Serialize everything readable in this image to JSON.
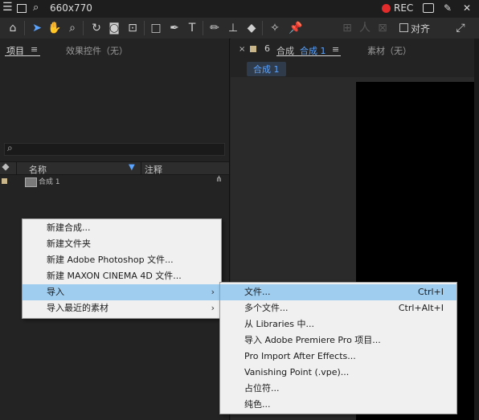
{
  "capture_bar": {
    "size_label": "660x770",
    "rec_label": "REC"
  },
  "toolbar": {
    "snap_label": "对齐"
  },
  "left_panel": {
    "tabs": [
      "项目",
      "效果控件（无）"
    ],
    "tab_menu_glyph": "≡",
    "search_icon_glyph": "⌕",
    "columns": {
      "name": "名称",
      "comment": "注释"
    },
    "items": [
      {
        "name": "合成 1"
      }
    ]
  },
  "right_panel": {
    "close_glyph": "×",
    "lock_glyph": "6",
    "comp_tab_prefix": "合成",
    "comp_tab_name": "合成 1",
    "tab_menu_glyph": "≡",
    "footage_tab": "素材（无）",
    "comp_pill": "合成 1"
  },
  "context_menu": {
    "items": [
      {
        "label": "新建合成..."
      },
      {
        "label": "新建文件夹"
      },
      {
        "label": "新建 Adobe Photoshop 文件..."
      },
      {
        "label": "新建 MAXON CINEMA 4D 文件..."
      },
      {
        "label": "导入",
        "submenu": true,
        "highlighted": true
      },
      {
        "label": "导入最近的素材",
        "submenu": true
      }
    ]
  },
  "import_submenu": {
    "items": [
      {
        "label": "文件...",
        "shortcut": "Ctrl+I",
        "highlighted": true
      },
      {
        "label": "多个文件...",
        "shortcut": "Ctrl+Alt+I"
      },
      {
        "label": "从 Libraries 中..."
      },
      {
        "label": "导入 Adobe Premiere Pro 项目..."
      },
      {
        "label": "Pro Import After Effects..."
      },
      {
        "label": "Vanishing Point (.vpe)..."
      },
      {
        "label": "占位符..."
      },
      {
        "label": "纯色..."
      }
    ]
  },
  "colors": {
    "accent": "#5ba4ff",
    "menu_highlight": "#9fcdf0",
    "rec": "#e22b2b"
  }
}
